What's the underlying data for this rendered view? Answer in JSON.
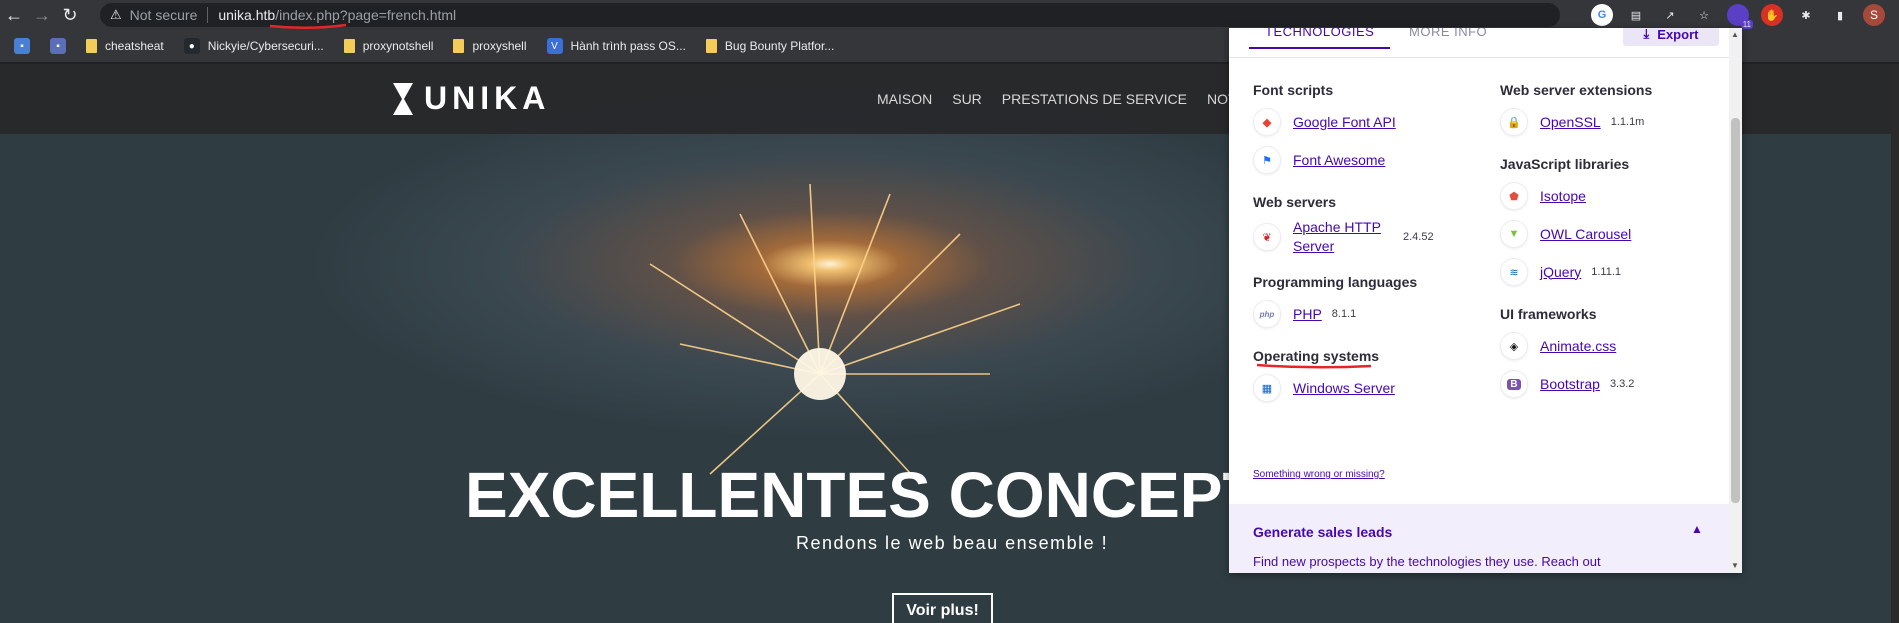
{
  "browser": {
    "security_label": "Not secure",
    "url_host": "unika.htb",
    "url_path": "/index.php?page=french.html",
    "extension_badge": "11",
    "avatar_initial": "S"
  },
  "bookmarks": [
    {
      "label": "",
      "icon": "translate-icon",
      "color": "#4a7fd6"
    },
    {
      "label": "",
      "icon": "bookmark-app-icon",
      "color": "#5b6fb8"
    },
    {
      "label": "cheatsheat",
      "icon": "folder-icon",
      "color": "#f2cd57"
    },
    {
      "label": "Nickyie/Cybersecuri...",
      "icon": "github-icon",
      "color": "#24292f"
    },
    {
      "label": "proxynotshell",
      "icon": "folder-icon",
      "color": "#f2cd57"
    },
    {
      "label": "proxyshell",
      "icon": "folder-icon",
      "color": "#f2cd57"
    },
    {
      "label": "Hành trình pass OS...",
      "icon": "v-logo-icon",
      "color": "#3a6fd8"
    },
    {
      "label": "Bug Bounty Platfor...",
      "icon": "folder-icon",
      "color": "#f2cd57"
    }
  ],
  "site": {
    "logo_text": "UNIKA",
    "nav": [
      "MAISON",
      "SUR",
      "PRESTATIONS DE SERVICE",
      "NOTRE"
    ],
    "hero_title": "EXCELLENTES CONCEPTION",
    "hero_subtitle": "Rendons le web beau ensemble !",
    "hero_button": "Voir plus!"
  },
  "wappalyzer": {
    "tab_technologies": "TECHNOLOGIES",
    "tab_more_info": "MORE INFO",
    "export_label": "Export",
    "left_groups": [
      {
        "category": "Font scripts",
        "items": [
          {
            "name": "Google Font API",
            "version": "",
            "icon": "google-font-icon"
          },
          {
            "name": "Font Awesome",
            "version": "",
            "icon": "font-awesome-flag-icon"
          }
        ]
      },
      {
        "category": "Web servers",
        "items": [
          {
            "name": "Apache HTTP Server",
            "version": "2.4.52",
            "icon": "apache-feather-icon"
          }
        ]
      },
      {
        "category": "Programming languages",
        "items": [
          {
            "name": "PHP",
            "version": "8.1.1",
            "icon": "php-icon"
          }
        ]
      },
      {
        "category": "Operating systems",
        "items": [
          {
            "name": "Windows Server",
            "version": "",
            "icon": "windows-icon"
          }
        ]
      }
    ],
    "right_groups": [
      {
        "category": "Web server extensions",
        "items": [
          {
            "name": "OpenSSL",
            "version": "1.1.1m",
            "icon": "lock-icon"
          }
        ]
      },
      {
        "category": "JavaScript libraries",
        "items": [
          {
            "name": "Isotope",
            "version": "",
            "icon": "isotope-icon"
          },
          {
            "name": "OWL Carousel",
            "version": "",
            "icon": "owl-icon"
          },
          {
            "name": "jQuery",
            "version": "1.11.1",
            "icon": "jquery-icon"
          }
        ]
      },
      {
        "category": "UI frameworks",
        "items": [
          {
            "name": "Animate.css",
            "version": "",
            "icon": "animate-icon"
          },
          {
            "name": "Bootstrap",
            "version": "3.3.2",
            "icon": "bootstrap-icon"
          }
        ]
      }
    ],
    "wrong_link": "Something wrong or missing?",
    "leads_title": "Generate sales leads",
    "leads_text": "Find new prospects by the technologies they use. Reach out"
  }
}
